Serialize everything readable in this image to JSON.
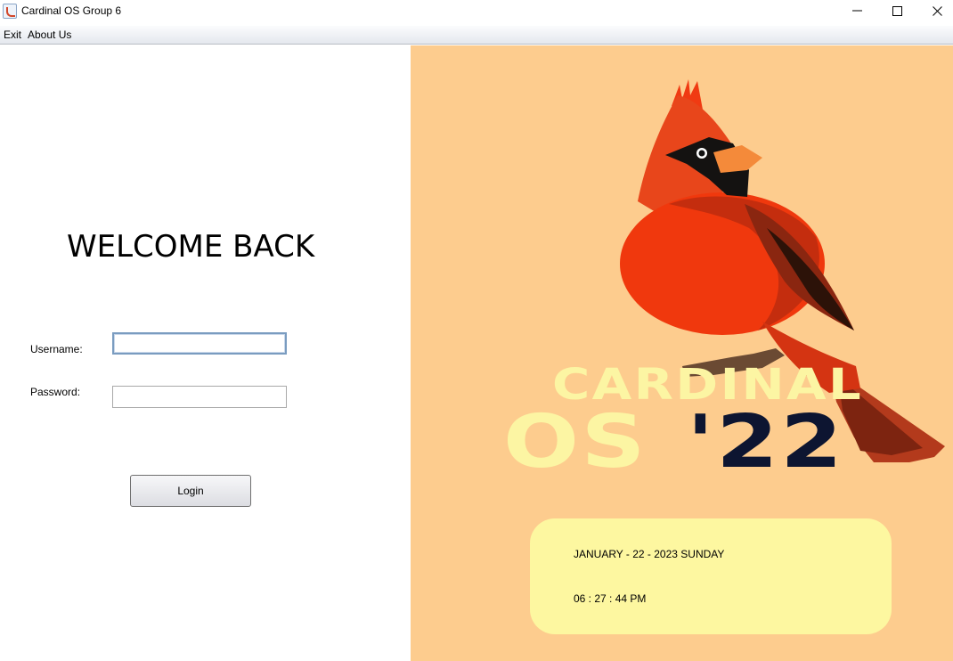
{
  "window": {
    "title": "Cardinal OS Group 6",
    "controls": {
      "minimize": "minimize-icon",
      "maximize": "maximize-icon",
      "close": "close-icon"
    }
  },
  "menu": {
    "items": [
      "Exit",
      "About Us"
    ]
  },
  "login": {
    "heading": "WELCOME BACK",
    "username_label": "Username:",
    "username_value": "",
    "password_label": "Password:",
    "password_value": "",
    "login_button": "Login"
  },
  "branding": {
    "word_cardinal": "CARDINAL",
    "word_os": "OS",
    "word_year": "'22",
    "colors": {
      "background": "#fdcc8e",
      "cream_text": "#fcf5a3",
      "navy_text": "#0d1531",
      "cardinal_red": "#f03a12"
    }
  },
  "clock": {
    "date": "JANUARY - 22 - 2023 SUNDAY",
    "time": "06 : 27 : 44 PM"
  }
}
